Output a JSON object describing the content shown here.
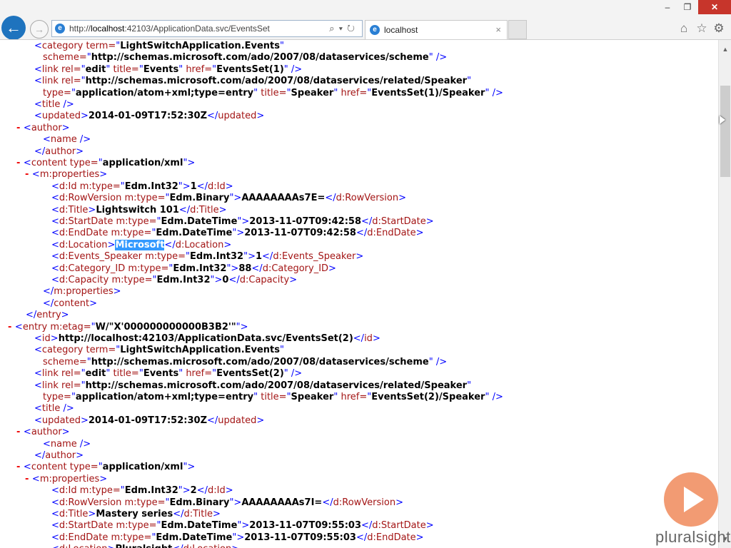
{
  "browser": {
    "address_host": "http://",
    "address_bold": "localhost",
    "address_rest": ":42103/ApplicationData.svc/EventsSet",
    "tab_title": "localhost",
    "tab_close": "×",
    "icons": [
      "back-arrow-icon",
      "forward-arrow-icon",
      "search-icon",
      "dropdown-icon",
      "refresh-icon",
      "home-icon",
      "star-icon",
      "gear-icon",
      "minimize-icon",
      "maximize-icon",
      "close-icon"
    ]
  },
  "brand": {
    "logo_text": "pluralsight",
    "accent": "#f08a5b"
  },
  "colors": {
    "tag": "#a31515",
    "punct": "#0000ff",
    "minus": "#ee0000",
    "highlight": "#3399ff"
  },
  "xml_lines": [
    [
      [
        "p",
        "<"
      ],
      [
        "t",
        "category"
      ],
      [
        "a",
        " term="
      ],
      [
        "p",
        "\""
      ],
      [
        "v",
        "LightSwitchApplication.Events"
      ],
      [
        "p",
        "\""
      ]
    ],
    [
      [
        "a",
        "scheme="
      ],
      [
        "p",
        "\""
      ],
      [
        "v",
        "http://schemas.microsoft.com/ado/2007/08/dataservices/scheme"
      ],
      [
        "p",
        "\" />"
      ]
    ],
    [
      [
        "p",
        "<"
      ],
      [
        "t",
        "link"
      ],
      [
        "a",
        " rel="
      ],
      [
        "p",
        "\""
      ],
      [
        "v",
        "edit"
      ],
      [
        "p",
        "\""
      ],
      [
        "a",
        " title="
      ],
      [
        "p",
        "\""
      ],
      [
        "v",
        "Events"
      ],
      [
        "p",
        "\""
      ],
      [
        "a",
        " href="
      ],
      [
        "p",
        "\""
      ],
      [
        "v",
        "EventsSet(1)"
      ],
      [
        "p",
        "\" />"
      ]
    ],
    [
      [
        "p",
        "<"
      ],
      [
        "t",
        "link"
      ],
      [
        "a",
        " rel="
      ],
      [
        "p",
        "\""
      ],
      [
        "v",
        "http://schemas.microsoft.com/ado/2007/08/dataservices/related/Speaker"
      ],
      [
        "p",
        "\""
      ]
    ],
    [
      [
        "a",
        "type="
      ],
      [
        "p",
        "\""
      ],
      [
        "v",
        "application/atom+xml;type=entry"
      ],
      [
        "p",
        "\""
      ],
      [
        "a",
        " title="
      ],
      [
        "p",
        "\""
      ],
      [
        "v",
        "Speaker"
      ],
      [
        "p",
        "\""
      ],
      [
        "a",
        " href="
      ],
      [
        "p",
        "\""
      ],
      [
        "v",
        "EventsSet(1)/Speaker"
      ],
      [
        "p",
        "\" />"
      ]
    ],
    [
      [
        "p",
        "<"
      ],
      [
        "t",
        "title"
      ],
      [
        "p",
        " />"
      ]
    ],
    [
      [
        "p",
        "<"
      ],
      [
        "t",
        "updated"
      ],
      [
        "p",
        ">"
      ],
      [
        "tx",
        "2014-01-09T17:52:30Z"
      ],
      [
        "p",
        "</"
      ],
      [
        "t",
        "updated"
      ],
      [
        "p",
        ">"
      ]
    ],
    [
      [
        "m",
        "- "
      ],
      [
        "p",
        "<"
      ],
      [
        "t",
        "author"
      ],
      [
        "p",
        ">"
      ]
    ],
    [
      [
        "p",
        "<"
      ],
      [
        "t",
        "name"
      ],
      [
        "p",
        " />"
      ]
    ],
    [
      [
        "p",
        "</"
      ],
      [
        "t",
        "author"
      ],
      [
        "p",
        ">"
      ]
    ],
    [
      [
        "m",
        "- "
      ],
      [
        "p",
        "<"
      ],
      [
        "t",
        "content"
      ],
      [
        "a",
        " type="
      ],
      [
        "p",
        "\""
      ],
      [
        "v",
        "application/xml"
      ],
      [
        "p",
        "\">"
      ]
    ],
    [
      [
        "m",
        "- "
      ],
      [
        "p",
        "<"
      ],
      [
        "t",
        "m:properties"
      ],
      [
        "p",
        ">"
      ]
    ],
    [
      [
        "p",
        "<"
      ],
      [
        "t",
        "d:Id"
      ],
      [
        "a",
        " m:type="
      ],
      [
        "p",
        "\""
      ],
      [
        "v",
        "Edm.Int32"
      ],
      [
        "p",
        "\">"
      ],
      [
        "tx",
        "1"
      ],
      [
        "p",
        "</"
      ],
      [
        "t",
        "d:Id"
      ],
      [
        "p",
        ">"
      ]
    ],
    [
      [
        "p",
        "<"
      ],
      [
        "t",
        "d:RowVersion"
      ],
      [
        "a",
        " m:type="
      ],
      [
        "p",
        "\""
      ],
      [
        "v",
        "Edm.Binary"
      ],
      [
        "p",
        "\">"
      ],
      [
        "tx",
        "AAAAAAAAs7E="
      ],
      [
        "p",
        "</"
      ],
      [
        "t",
        "d:RowVersion"
      ],
      [
        "p",
        ">"
      ]
    ],
    [
      [
        "p",
        "<"
      ],
      [
        "t",
        "d:Title"
      ],
      [
        "p",
        ">"
      ],
      [
        "tx",
        "Lightswitch 101"
      ],
      [
        "p",
        "</"
      ],
      [
        "t",
        "d:Title"
      ],
      [
        "p",
        ">"
      ]
    ],
    [
      [
        "p",
        "<"
      ],
      [
        "t",
        "d:StartDate"
      ],
      [
        "a",
        " m:type="
      ],
      [
        "p",
        "\""
      ],
      [
        "v",
        "Edm.DateTime"
      ],
      [
        "p",
        "\">"
      ],
      [
        "tx",
        "2013-11-07T09:42:58"
      ],
      [
        "p",
        "</"
      ],
      [
        "t",
        "d:StartDate"
      ],
      [
        "p",
        ">"
      ]
    ],
    [
      [
        "p",
        "<"
      ],
      [
        "t",
        "d:EndDate"
      ],
      [
        "a",
        " m:type="
      ],
      [
        "p",
        "\""
      ],
      [
        "v",
        "Edm.DateTime"
      ],
      [
        "p",
        "\">"
      ],
      [
        "tx",
        "2013-11-07T09:42:58"
      ],
      [
        "p",
        "</"
      ],
      [
        "t",
        "d:EndDate"
      ],
      [
        "p",
        ">"
      ]
    ],
    [
      [
        "p",
        "<"
      ],
      [
        "t",
        "d:Location"
      ],
      [
        "p",
        ">"
      ],
      [
        "hl",
        "Microsoft"
      ],
      [
        "p",
        "</"
      ],
      [
        "t",
        "d:Location"
      ],
      [
        "p",
        ">"
      ]
    ],
    [
      [
        "p",
        "<"
      ],
      [
        "t",
        "d:Events_Speaker"
      ],
      [
        "a",
        " m:type="
      ],
      [
        "p",
        "\""
      ],
      [
        "v",
        "Edm.Int32"
      ],
      [
        "p",
        "\">"
      ],
      [
        "tx",
        "1"
      ],
      [
        "p",
        "</"
      ],
      [
        "t",
        "d:Events_Speaker"
      ],
      [
        "p",
        ">"
      ]
    ],
    [
      [
        "p",
        "<"
      ],
      [
        "t",
        "d:Category_ID"
      ],
      [
        "a",
        " m:type="
      ],
      [
        "p",
        "\""
      ],
      [
        "v",
        "Edm.Int32"
      ],
      [
        "p",
        "\">"
      ],
      [
        "tx",
        "88"
      ],
      [
        "p",
        "</"
      ],
      [
        "t",
        "d:Category_ID"
      ],
      [
        "p",
        ">"
      ]
    ],
    [
      [
        "p",
        "<"
      ],
      [
        "t",
        "d:Capacity"
      ],
      [
        "a",
        " m:type="
      ],
      [
        "p",
        "\""
      ],
      [
        "v",
        "Edm.Int32"
      ],
      [
        "p",
        "\">"
      ],
      [
        "tx",
        "0"
      ],
      [
        "p",
        "</"
      ],
      [
        "t",
        "d:Capacity"
      ],
      [
        "p",
        ">"
      ]
    ],
    [
      [
        "p",
        "</"
      ],
      [
        "t",
        "m:properties"
      ],
      [
        "p",
        ">"
      ]
    ],
    [
      [
        "p",
        "</"
      ],
      [
        "t",
        "content"
      ],
      [
        "p",
        ">"
      ]
    ],
    [
      [
        "p",
        "</"
      ],
      [
        "t",
        "entry"
      ],
      [
        "p",
        ">"
      ]
    ],
    [
      [
        "m",
        "- "
      ],
      [
        "p",
        "<"
      ],
      [
        "t",
        "entry"
      ],
      [
        "a",
        " m:etag="
      ],
      [
        "p",
        "\""
      ],
      [
        "v",
        "W/\"X'000000000000B3B2'\""
      ],
      [
        "p",
        "\">"
      ]
    ],
    [
      [
        "p",
        "<"
      ],
      [
        "t",
        "id"
      ],
      [
        "p",
        ">"
      ],
      [
        "tx",
        "http://localhost:42103/ApplicationData.svc/EventsSet(2)"
      ],
      [
        "p",
        "</"
      ],
      [
        "t",
        "id"
      ],
      [
        "p",
        ">"
      ]
    ],
    [
      [
        "p",
        "<"
      ],
      [
        "t",
        "category"
      ],
      [
        "a",
        " term="
      ],
      [
        "p",
        "\""
      ],
      [
        "v",
        "LightSwitchApplication.Events"
      ],
      [
        "p",
        "\""
      ]
    ],
    [
      [
        "a",
        "scheme="
      ],
      [
        "p",
        "\""
      ],
      [
        "v",
        "http://schemas.microsoft.com/ado/2007/08/dataservices/scheme"
      ],
      [
        "p",
        "\" />"
      ]
    ],
    [
      [
        "p",
        "<"
      ],
      [
        "t",
        "link"
      ],
      [
        "a",
        " rel="
      ],
      [
        "p",
        "\""
      ],
      [
        "v",
        "edit"
      ],
      [
        "p",
        "\""
      ],
      [
        "a",
        " title="
      ],
      [
        "p",
        "\""
      ],
      [
        "v",
        "Events"
      ],
      [
        "p",
        "\""
      ],
      [
        "a",
        " href="
      ],
      [
        "p",
        "\""
      ],
      [
        "v",
        "EventsSet(2)"
      ],
      [
        "p",
        "\" />"
      ]
    ],
    [
      [
        "p",
        "<"
      ],
      [
        "t",
        "link"
      ],
      [
        "a",
        " rel="
      ],
      [
        "p",
        "\""
      ],
      [
        "v",
        "http://schemas.microsoft.com/ado/2007/08/dataservices/related/Speaker"
      ],
      [
        "p",
        "\""
      ]
    ],
    [
      [
        "a",
        "type="
      ],
      [
        "p",
        "\""
      ],
      [
        "v",
        "application/atom+xml;type=entry"
      ],
      [
        "p",
        "\""
      ],
      [
        "a",
        " title="
      ],
      [
        "p",
        "\""
      ],
      [
        "v",
        "Speaker"
      ],
      [
        "p",
        "\""
      ],
      [
        "a",
        " href="
      ],
      [
        "p",
        "\""
      ],
      [
        "v",
        "EventsSet(2)/Speaker"
      ],
      [
        "p",
        "\" />"
      ]
    ],
    [
      [
        "p",
        "<"
      ],
      [
        "t",
        "title"
      ],
      [
        "p",
        " />"
      ]
    ],
    [
      [
        "p",
        "<"
      ],
      [
        "t",
        "updated"
      ],
      [
        "p",
        ">"
      ],
      [
        "tx",
        "2014-01-09T17:52:30Z"
      ],
      [
        "p",
        "</"
      ],
      [
        "t",
        "updated"
      ],
      [
        "p",
        ">"
      ]
    ],
    [
      [
        "m",
        "- "
      ],
      [
        "p",
        "<"
      ],
      [
        "t",
        "author"
      ],
      [
        "p",
        ">"
      ]
    ],
    [
      [
        "p",
        "<"
      ],
      [
        "t",
        "name"
      ],
      [
        "p",
        " />"
      ]
    ],
    [
      [
        "p",
        "</"
      ],
      [
        "t",
        "author"
      ],
      [
        "p",
        ">"
      ]
    ],
    [
      [
        "m",
        "- "
      ],
      [
        "p",
        "<"
      ],
      [
        "t",
        "content"
      ],
      [
        "a",
        " type="
      ],
      [
        "p",
        "\""
      ],
      [
        "v",
        "application/xml"
      ],
      [
        "p",
        "\">"
      ]
    ],
    [
      [
        "m",
        "- "
      ],
      [
        "p",
        "<"
      ],
      [
        "t",
        "m:properties"
      ],
      [
        "p",
        ">"
      ]
    ],
    [
      [
        "p",
        "<"
      ],
      [
        "t",
        "d:Id"
      ],
      [
        "a",
        " m:type="
      ],
      [
        "p",
        "\""
      ],
      [
        "v",
        "Edm.Int32"
      ],
      [
        "p",
        "\">"
      ],
      [
        "tx",
        "2"
      ],
      [
        "p",
        "</"
      ],
      [
        "t",
        "d:Id"
      ],
      [
        "p",
        ">"
      ]
    ],
    [
      [
        "p",
        "<"
      ],
      [
        "t",
        "d:RowVersion"
      ],
      [
        "a",
        " m:type="
      ],
      [
        "p",
        "\""
      ],
      [
        "v",
        "Edm.Binary"
      ],
      [
        "p",
        "\">"
      ],
      [
        "tx",
        "AAAAAAAAs7I="
      ],
      [
        "p",
        "</"
      ],
      [
        "t",
        "d:RowVersion"
      ],
      [
        "p",
        ">"
      ]
    ],
    [
      [
        "p",
        "<"
      ],
      [
        "t",
        "d:Title"
      ],
      [
        "p",
        ">"
      ],
      [
        "tx",
        "Mastery series"
      ],
      [
        "p",
        "</"
      ],
      [
        "t",
        "d:Title"
      ],
      [
        "p",
        ">"
      ]
    ],
    [
      [
        "p",
        "<"
      ],
      [
        "t",
        "d:StartDate"
      ],
      [
        "a",
        " m:type="
      ],
      [
        "p",
        "\""
      ],
      [
        "v",
        "Edm.DateTime"
      ],
      [
        "p",
        "\">"
      ],
      [
        "tx",
        "2013-11-07T09:55:03"
      ],
      [
        "p",
        "</"
      ],
      [
        "t",
        "d:StartDate"
      ],
      [
        "p",
        ">"
      ]
    ],
    [
      [
        "p",
        "<"
      ],
      [
        "t",
        "d:EndDate"
      ],
      [
        "a",
        " m:type="
      ],
      [
        "p",
        "\""
      ],
      [
        "v",
        "Edm.DateTime"
      ],
      [
        "p",
        "\">"
      ],
      [
        "tx",
        "2013-11-07T09:55:03"
      ],
      [
        "p",
        "</"
      ],
      [
        "t",
        "d:EndDate"
      ],
      [
        "p",
        ">"
      ]
    ],
    [
      [
        "p",
        "<"
      ],
      [
        "t",
        "d:Location"
      ],
      [
        "p",
        ">"
      ],
      [
        "tx",
        "Pluralsight"
      ],
      [
        "p",
        "</"
      ],
      [
        "t",
        "d:Location"
      ],
      [
        "p",
        ">"
      ]
    ]
  ]
}
